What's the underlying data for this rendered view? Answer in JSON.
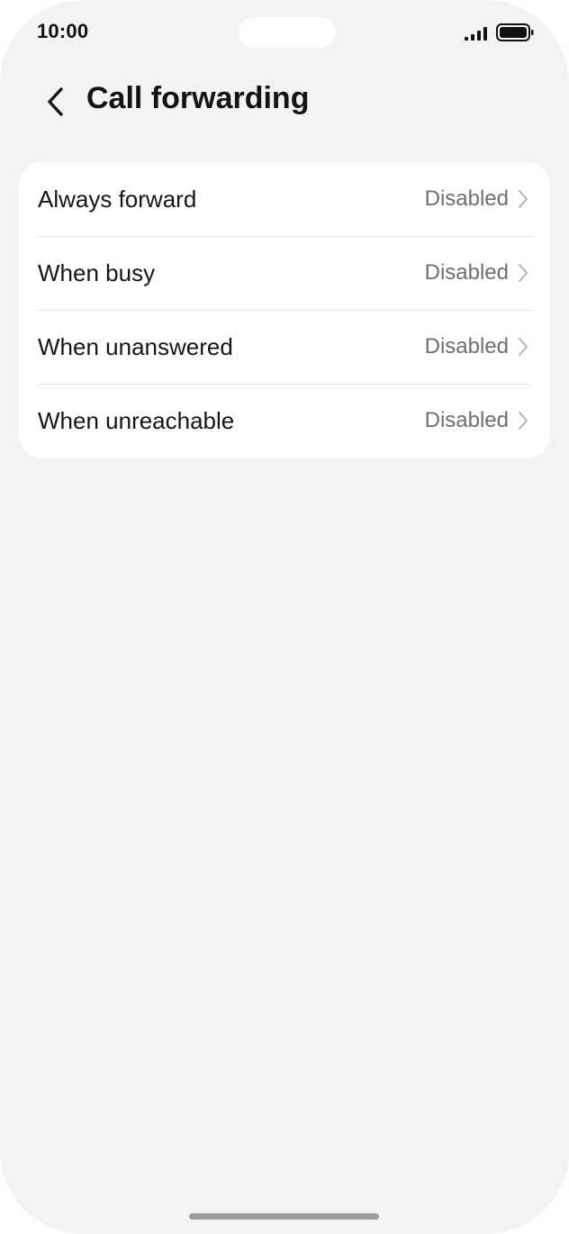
{
  "status_bar": {
    "time": "10:00",
    "signal_icon": "cellular-signal-icon",
    "battery_icon": "battery-full-icon"
  },
  "header": {
    "back_icon": "chevron-left-icon",
    "title": "Call forwarding"
  },
  "options": [
    {
      "label": "Always forward",
      "value": "Disabled"
    },
    {
      "label": "When busy",
      "value": "Disabled"
    },
    {
      "label": "When unanswered",
      "value": "Disabled"
    },
    {
      "label": "When unreachable",
      "value": "Disabled"
    }
  ],
  "colors": {
    "background": "#f2f3f5",
    "card": "#ffffff",
    "primary_text": "#161616",
    "secondary_text": "#6f6f6f"
  }
}
